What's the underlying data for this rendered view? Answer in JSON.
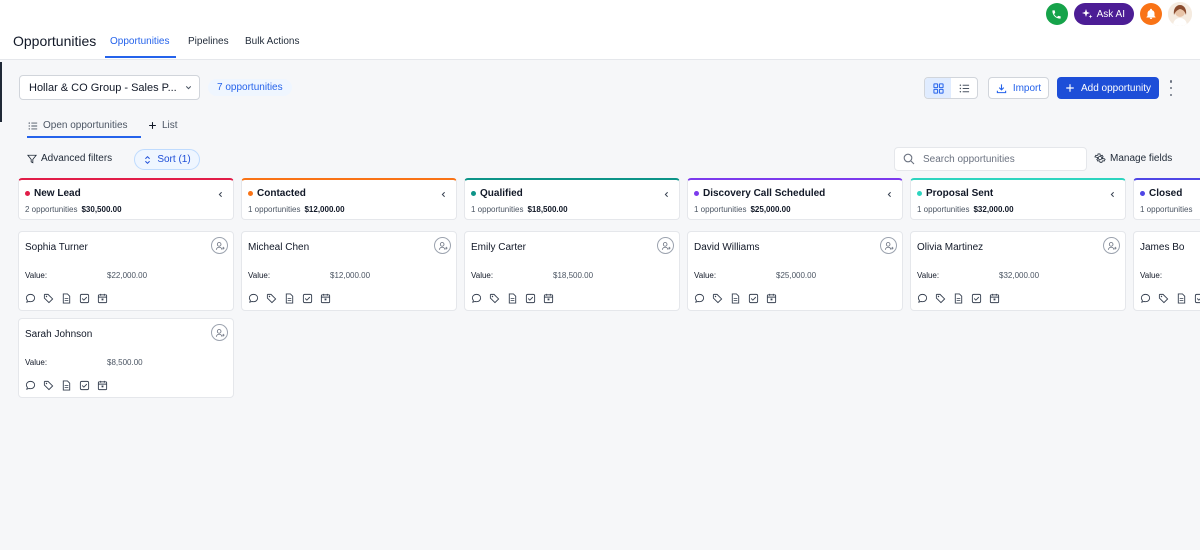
{
  "header": {
    "title": "Opportunities",
    "tabs": [
      {
        "label": "Opportunities"
      },
      {
        "label": "Pipelines"
      },
      {
        "label": "Bulk Actions"
      }
    ],
    "ask_ai_label": "Ask AI"
  },
  "toolbar": {
    "pipeline_name": "Hollar & CO Group - Sales P...",
    "opportunity_count": "7 opportunities",
    "import_label": "Import",
    "add_label": "Add opportunity"
  },
  "views": {
    "open_label": "Open opportunities",
    "add_list_label": "List"
  },
  "filters": {
    "advanced_label": "Advanced filters",
    "sort_label": "Sort (1)",
    "search_placeholder": "Search opportunities",
    "manage_fields_label": "Manage fields"
  },
  "card_value_label": "Value:",
  "columns": [
    {
      "name": "New Lead",
      "count": "2 opportunities",
      "total": "$30,500.00",
      "color": "#e11d48",
      "cards": [
        {
          "name": "Sophia Turner",
          "value": "$22,000.00"
        },
        {
          "name": "Sarah Johnson",
          "value": "$8,500.00"
        }
      ]
    },
    {
      "name": "Contacted",
      "count": "1 opportunities",
      "total": "$12,000.00",
      "color": "#f97316",
      "cards": [
        {
          "name": "Micheal Chen",
          "value": "$12,000.00"
        }
      ]
    },
    {
      "name": "Qualified",
      "count": "1 opportunities",
      "total": "$18,500.00",
      "color": "#0d9488",
      "cards": [
        {
          "name": "Emily Carter",
          "value": "$18,500.00"
        }
      ]
    },
    {
      "name": "Discovery Call Scheduled",
      "count": "1 opportunities",
      "total": "$25,000.00",
      "color": "#7c3aed",
      "cards": [
        {
          "name": "David Williams",
          "value": "$25,000.00"
        }
      ]
    },
    {
      "name": "Proposal Sent",
      "count": "1 opportunities",
      "total": "$32,000.00",
      "color": "#2dd4bf",
      "cards": [
        {
          "name": "Olivia Martinez",
          "value": "$32,000.00"
        }
      ]
    },
    {
      "name": "Closed",
      "count": "1 opportunities",
      "total": "",
      "color": "#4f46e5",
      "cards": [
        {
          "name": "James Bo",
          "value": ""
        }
      ]
    }
  ]
}
